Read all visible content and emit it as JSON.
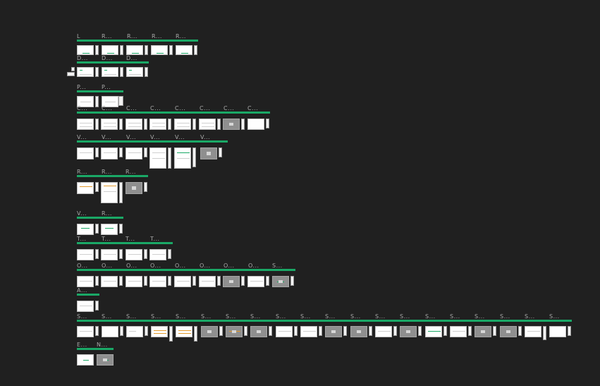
{
  "overview": {
    "background": "#202020",
    "accent": "#1aa866",
    "sections": [
      {
        "id": "s1",
        "labels": [
          "L",
          "R...",
          "R...",
          "R...",
          "R..."
        ],
        "frames": 5
      },
      {
        "id": "s2",
        "labels": [
          "D...",
          "D...",
          "D..."
        ],
        "frames": 3
      },
      {
        "id": "s3",
        "labels": [
          "P...",
          "P..."
        ],
        "frames": 2
      },
      {
        "id": "s4",
        "labels": [
          "C...",
          "C...",
          "C...",
          "C...",
          "C...",
          "C...",
          "C...",
          "C..."
        ],
        "frames": 8
      },
      {
        "id": "s5",
        "labels": [
          "V...",
          "V...",
          "V...",
          "V...",
          "V...",
          "V..."
        ],
        "frames": 6
      },
      {
        "id": "s6",
        "labels": [
          "R...",
          "R...",
          "R..."
        ],
        "frames": 3
      },
      {
        "id": "s7",
        "labels": [
          "V...",
          "R..."
        ],
        "frames": 2
      },
      {
        "id": "s8",
        "labels": [
          "T...",
          "T...",
          "T...",
          "T..."
        ],
        "frames": 4
      },
      {
        "id": "s9",
        "labels": [
          "O...",
          "O...",
          "O...",
          "O...",
          "O...",
          "O...",
          "O...",
          "O...",
          "S..."
        ],
        "frames": 9
      },
      {
        "id": "s10",
        "labels": [
          "A..."
        ],
        "frames": 1
      },
      {
        "id": "s11",
        "labels": [
          "S...",
          "S...",
          "S...",
          "S...",
          "S...",
          "S...",
          "S...",
          "S...",
          "S...",
          "S...",
          "S...",
          "S...",
          "S...",
          "S...",
          "S...",
          "S...",
          "S...",
          "S...",
          "S...",
          "S..."
        ],
        "frames": 20
      },
      {
        "id": "s12",
        "labels": [
          "E...",
          "N..."
        ],
        "frames": 2
      }
    ]
  }
}
